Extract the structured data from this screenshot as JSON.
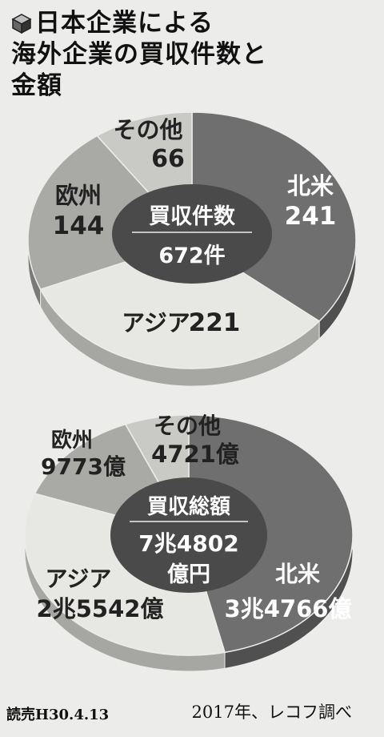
{
  "title_line1": "日本企業による",
  "title_line2": "海外企業の買収件数と",
  "title_line3": "金額",
  "chart_data": [
    {
      "type": "pie",
      "center_label": "買収件数",
      "center_value": "672件",
      "slices": [
        {
          "name": "北米",
          "value": 241,
          "label": "241",
          "color": "#6f6f6f"
        },
        {
          "name": "アジア",
          "value": 221,
          "label": "221",
          "color": "#e7e7e3"
        },
        {
          "name": "欧州",
          "value": 144,
          "label": "144",
          "color": "#a9a9a6"
        },
        {
          "name": "その他",
          "value": 66,
          "label": "66",
          "color": "#c9c9c6"
        }
      ]
    },
    {
      "type": "pie",
      "center_label": "買収総額",
      "center_value_line1": "7兆4802",
      "center_value_line2": "億円",
      "slices": [
        {
          "name": "北米",
          "value": 34766,
          "label": "3兆4766億",
          "color": "#6f6f6f"
        },
        {
          "name": "アジア",
          "value": 25542,
          "label": "2兆5542億",
          "color": "#e7e7e3"
        },
        {
          "name": "欧州",
          "value": 9773,
          "label": "9773億",
          "color": "#a9a9a6"
        },
        {
          "name": "その他",
          "value": 4721,
          "label": "4721億",
          "color": "#c9c9c6"
        }
      ]
    }
  ],
  "source_left": "読売H30.4.13",
  "source_right": "2017年、レコフ調べ"
}
